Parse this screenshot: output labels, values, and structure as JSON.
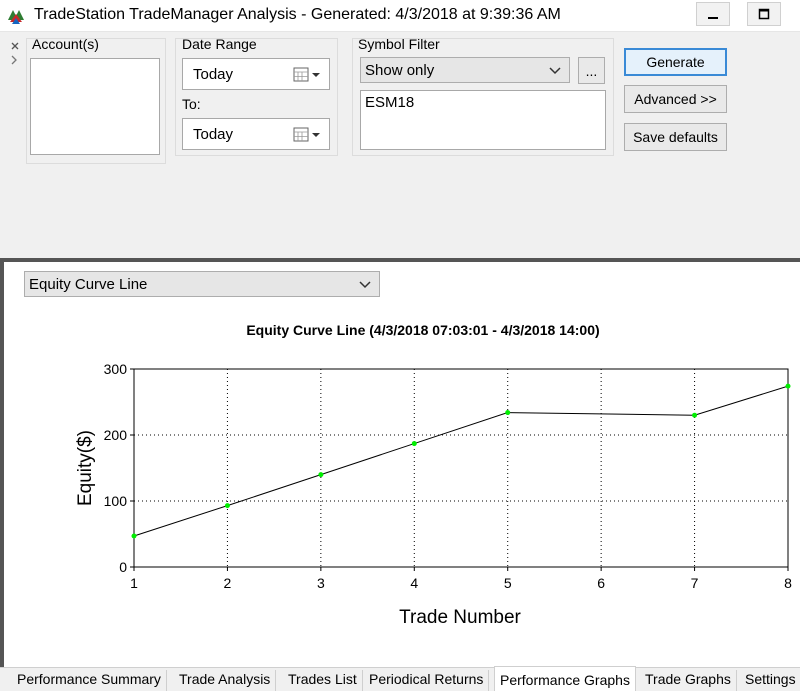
{
  "window": {
    "title": "TradeStation TradeManager Analysis - Generated: 4/3/2018 at 9:39:36 AM"
  },
  "controls": {
    "accounts_label": "Account(s)",
    "date_range_label": "Date Range",
    "from_value": "Today",
    "to_label": "To:",
    "to_value": "Today",
    "symbol_filter_label": "Symbol Filter",
    "symbol_mode": "Show only",
    "symbol_browse_label": "...",
    "symbols": "ESM18",
    "generate_label": "Generate",
    "advanced_label": "Advanced >>",
    "save_defaults_label": "Save defaults"
  },
  "graph_selector": {
    "selected": "Equity Curve Line"
  },
  "chart_data": {
    "type": "line",
    "title": "Equity Curve Line (4/3/2018 07:03:01 - 4/3/2018 14:00)",
    "xlabel": "Trade Number",
    "ylabel": "Equity($)",
    "x": [
      1,
      2,
      3,
      4,
      5,
      6,
      7,
      8
    ],
    "xticks": [
      "1",
      "2",
      "3",
      "4",
      "5",
      "6",
      "7",
      "8"
    ],
    "yticks": [
      "0",
      "100",
      "200",
      "300"
    ],
    "xlim": [
      1,
      8
    ],
    "ylim": [
      0,
      300
    ],
    "grid": true,
    "series": [
      {
        "color": "#000000",
        "marker_color": "#00ee00",
        "points": [
          {
            "x": 1,
            "y": 47
          },
          {
            "x": 2,
            "y": 93
          },
          {
            "x": 3,
            "y": 140
          },
          {
            "x": 4,
            "y": 187
          },
          {
            "x": 5,
            "y": 234
          },
          {
            "x": 7,
            "y": 230
          },
          {
            "x": 8,
            "y": 274
          }
        ]
      }
    ]
  },
  "tabs": [
    {
      "label": "Performance Summary"
    },
    {
      "label": "Trade Analysis"
    },
    {
      "label": "Trades List"
    },
    {
      "label": "Periodical Returns"
    },
    {
      "label": "Performance Graphs"
    },
    {
      "label": "Trade Graphs"
    },
    {
      "label": "Settings"
    }
  ],
  "active_tab": "Performance Graphs",
  "colors": {
    "accent": "#3a8ad6",
    "marker": "#00ee00"
  }
}
